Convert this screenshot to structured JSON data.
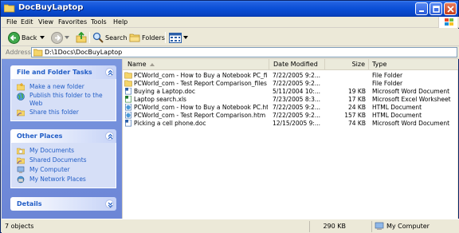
{
  "window": {
    "title": "DocBuyLaptop"
  },
  "menu": {
    "items": [
      "File",
      "Edit",
      "View",
      "Favorites",
      "Tools",
      "Help"
    ]
  },
  "toolbar": {
    "back": "Back",
    "search": "Search",
    "folders": "Folders"
  },
  "address": {
    "label": "Address",
    "path": "D:\\1Docs\\DocBuyLaptop"
  },
  "left_pane": {
    "file_tasks": {
      "title": "File and Folder Tasks",
      "items": [
        "Make a new folder",
        "Publish this folder to the Web",
        "Share this folder"
      ]
    },
    "other_places": {
      "title": "Other Places",
      "items": [
        "My Documents",
        "Shared Documents",
        "My Computer",
        "My Network Places"
      ]
    },
    "details": {
      "title": "Details"
    }
  },
  "columns": {
    "name": "Name",
    "date": "Date Modified",
    "size": "Size",
    "type": "Type"
  },
  "files": [
    {
      "name": "PCWorld_com - How to Buy a Notebook PC_files",
      "date": "7/22/2005 9:2...",
      "size": "",
      "type": "File Folder",
      "icon": "folder-icon"
    },
    {
      "name": "PCWorld_com - Test Report Comparison_files",
      "date": "7/22/2005 9:2...",
      "size": "",
      "type": "File Folder",
      "icon": "folder-icon"
    },
    {
      "name": "Buying a Laptop.doc",
      "date": "5/11/2004 10:...",
      "size": "19 KB",
      "type": "Microsoft Word Document",
      "icon": "word-doc-icon"
    },
    {
      "name": "Laptop search.xls",
      "date": "7/23/2005 8:3...",
      "size": "17 KB",
      "type": "Microsoft Excel Worksheet",
      "icon": "excel-icon"
    },
    {
      "name": "PCWorld_com - How to Buy a Notebook PC.htm",
      "date": "7/22/2005 9:2...",
      "size": "24 KB",
      "type": "HTML Document",
      "icon": "html-icon"
    },
    {
      "name": "PCWorld_com - Test Report Comparison.htm",
      "date": "7/22/2005 9:2...",
      "size": "157 KB",
      "type": "HTML Document",
      "icon": "html-icon"
    },
    {
      "name": "Picking a cell phone.doc",
      "date": "12/15/2005 9:...",
      "size": "74 KB",
      "type": "Microsoft Word Document",
      "icon": "word-doc-icon"
    }
  ],
  "status": {
    "objects": "7 objects",
    "size": "290 KB",
    "location": "My Computer"
  },
  "colors": {
    "titlebar": "#0a4fd6",
    "task_pane": "#6c86d6",
    "link": "#215dc6"
  }
}
